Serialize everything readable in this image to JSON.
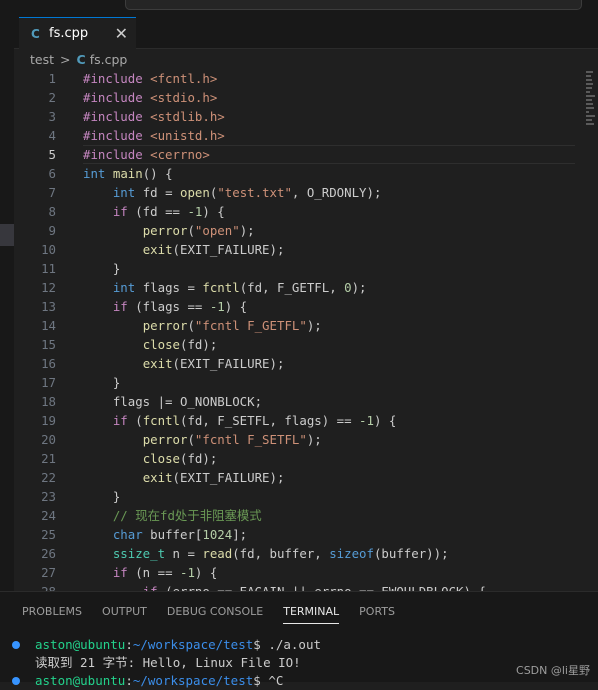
{
  "tab": {
    "icon": "C",
    "label": "fs.cpp",
    "close": "✕"
  },
  "breadcrumb": {
    "folder": "test",
    "sep": ">",
    "file_icon": "C",
    "file": "fs.cpp"
  },
  "colors": {
    "keyword": "#569cd6",
    "control": "#c586c0",
    "function": "#dcdcaa",
    "string": "#ce9178",
    "number": "#b5cea8",
    "type": "#4ec9b0",
    "comment": "#6a9955",
    "macro": "#4fc1ff",
    "text": "#cccccc"
  },
  "code_lines": [
    {
      "n": "1",
      "tokens": [
        [
          "#include ",
          "control"
        ],
        [
          "<fcntl.h>",
          "string"
        ]
      ]
    },
    {
      "n": "2",
      "tokens": [
        [
          "#include ",
          "control"
        ],
        [
          "<stdio.h>",
          "string"
        ]
      ]
    },
    {
      "n": "3",
      "tokens": [
        [
          "#include ",
          "control"
        ],
        [
          "<stdlib.h>",
          "string"
        ]
      ]
    },
    {
      "n": "4",
      "tokens": [
        [
          "#include ",
          "control"
        ],
        [
          "<unistd.h>",
          "string"
        ]
      ]
    },
    {
      "n": "5",
      "tokens": [
        [
          "#include ",
          "control"
        ],
        [
          "<cerrno>",
          "string"
        ]
      ]
    },
    {
      "n": "6",
      "tokens": [
        [
          "int",
          "keyword"
        ],
        [
          " ",
          "text"
        ],
        [
          "main",
          "function"
        ],
        [
          "() {",
          "text"
        ]
      ]
    },
    {
      "n": "7",
      "tokens": [
        [
          "    ",
          "text"
        ],
        [
          "int",
          "keyword"
        ],
        [
          " fd = ",
          "text"
        ],
        [
          "open",
          "function"
        ],
        [
          "(",
          "text"
        ],
        [
          "\"test.txt\"",
          "string"
        ],
        [
          ", O_RDONLY);",
          "text"
        ]
      ]
    },
    {
      "n": "8",
      "tokens": [
        [
          "    ",
          "text"
        ],
        [
          "if",
          "control"
        ],
        [
          " (fd == ",
          "text"
        ],
        [
          "-1",
          "number"
        ],
        [
          ") {",
          "text"
        ]
      ]
    },
    {
      "n": "9",
      "tokens": [
        [
          "        ",
          "text"
        ],
        [
          "perror",
          "function"
        ],
        [
          "(",
          "text"
        ],
        [
          "\"open\"",
          "string"
        ],
        [
          ");",
          "text"
        ]
      ]
    },
    {
      "n": "10",
      "tokens": [
        [
          "        ",
          "text"
        ],
        [
          "exit",
          "function"
        ],
        [
          "(EXIT_FAILURE);",
          "text"
        ]
      ]
    },
    {
      "n": "11",
      "tokens": [
        [
          "    }",
          "text"
        ]
      ]
    },
    {
      "n": "12",
      "tokens": [
        [
          "    ",
          "text"
        ],
        [
          "int",
          "keyword"
        ],
        [
          " flags = ",
          "text"
        ],
        [
          "fcntl",
          "function"
        ],
        [
          "(fd, F_GETFL, ",
          "text"
        ],
        [
          "0",
          "number"
        ],
        [
          ");",
          "text"
        ]
      ]
    },
    {
      "n": "13",
      "tokens": [
        [
          "    ",
          "text"
        ],
        [
          "if",
          "control"
        ],
        [
          " (flags == ",
          "text"
        ],
        [
          "-1",
          "number"
        ],
        [
          ") {",
          "text"
        ]
      ]
    },
    {
      "n": "14",
      "tokens": [
        [
          "        ",
          "text"
        ],
        [
          "perror",
          "function"
        ],
        [
          "(",
          "text"
        ],
        [
          "\"fcntl F_GETFL\"",
          "string"
        ],
        [
          ");",
          "text"
        ]
      ]
    },
    {
      "n": "15",
      "tokens": [
        [
          "        ",
          "text"
        ],
        [
          "close",
          "function"
        ],
        [
          "(fd);",
          "text"
        ]
      ]
    },
    {
      "n": "16",
      "tokens": [
        [
          "        ",
          "text"
        ],
        [
          "exit",
          "function"
        ],
        [
          "(EXIT_FAILURE);",
          "text"
        ]
      ]
    },
    {
      "n": "17",
      "tokens": [
        [
          "    }",
          "text"
        ]
      ]
    },
    {
      "n": "18",
      "tokens": [
        [
          "    flags |= O_NONBLOCK;",
          "text"
        ]
      ]
    },
    {
      "n": "19",
      "tokens": [
        [
          "    ",
          "text"
        ],
        [
          "if",
          "control"
        ],
        [
          " (",
          "text"
        ],
        [
          "fcntl",
          "function"
        ],
        [
          "(fd, F_SETFL, flags) == ",
          "text"
        ],
        [
          "-1",
          "number"
        ],
        [
          ") {",
          "text"
        ]
      ]
    },
    {
      "n": "20",
      "tokens": [
        [
          "        ",
          "text"
        ],
        [
          "perror",
          "function"
        ],
        [
          "(",
          "text"
        ],
        [
          "\"fcntl F_SETFL\"",
          "string"
        ],
        [
          ");",
          "text"
        ]
      ]
    },
    {
      "n": "21",
      "tokens": [
        [
          "        ",
          "text"
        ],
        [
          "close",
          "function"
        ],
        [
          "(fd);",
          "text"
        ]
      ]
    },
    {
      "n": "22",
      "tokens": [
        [
          "        ",
          "text"
        ],
        [
          "exit",
          "function"
        ],
        [
          "(EXIT_FAILURE);",
          "text"
        ]
      ]
    },
    {
      "n": "23",
      "tokens": [
        [
          "    }",
          "text"
        ]
      ]
    },
    {
      "n": "24",
      "tokens": [
        [
          "    // 现在fd处于非阻塞模式",
          "comment"
        ]
      ]
    },
    {
      "n": "25",
      "tokens": [
        [
          "    ",
          "text"
        ],
        [
          "char",
          "keyword"
        ],
        [
          " buffer[",
          "text"
        ],
        [
          "1024",
          "number"
        ],
        [
          "];",
          "text"
        ]
      ]
    },
    {
      "n": "26",
      "tokens": [
        [
          "    ",
          "text"
        ],
        [
          "ssize_t",
          "type"
        ],
        [
          " n = ",
          "text"
        ],
        [
          "read",
          "function"
        ],
        [
          "(fd, buffer, ",
          "text"
        ],
        [
          "sizeof",
          "keyword"
        ],
        [
          "(buffer));",
          "text"
        ]
      ]
    },
    {
      "n": "27",
      "tokens": [
        [
          "    ",
          "text"
        ],
        [
          "if",
          "control"
        ],
        [
          " (n == ",
          "text"
        ],
        [
          "-1",
          "number"
        ],
        [
          ") {",
          "text"
        ]
      ]
    },
    {
      "n": "28",
      "tokens": [
        [
          "        ",
          "text"
        ],
        [
          "if",
          "control"
        ],
        [
          " (errno == EAGAIN || errno == EWOULDBLOCK) {",
          "text"
        ]
      ]
    }
  ],
  "panel": {
    "tabs": [
      "PROBLEMS",
      "OUTPUT",
      "DEBUG CONSOLE",
      "TERMINAL",
      "PORTS"
    ],
    "active_tab": "TERMINAL"
  },
  "terminal": [
    {
      "dot": "#3794ff",
      "tokens": [
        [
          "aston@ubuntu",
          "#23d18b"
        ],
        [
          ":",
          "#cccccc"
        ],
        [
          "~/workspace/test",
          "#3b8eea"
        ],
        [
          "$ ./a.out",
          "#cccccc"
        ]
      ]
    },
    {
      "dot": "",
      "tokens": [
        [
          "读取到 21 字节: Hello, Linux File IO!",
          "#cccccc"
        ]
      ]
    },
    {
      "dot": "#3794ff",
      "tokens": [
        [
          "aston@ubuntu",
          "#23d18b"
        ],
        [
          ":",
          "#cccccc"
        ],
        [
          "~/workspace/test",
          "#3b8eea"
        ],
        [
          "$ ^C",
          "#cccccc"
        ]
      ]
    }
  ],
  "watermark": "CSDN @li星野"
}
